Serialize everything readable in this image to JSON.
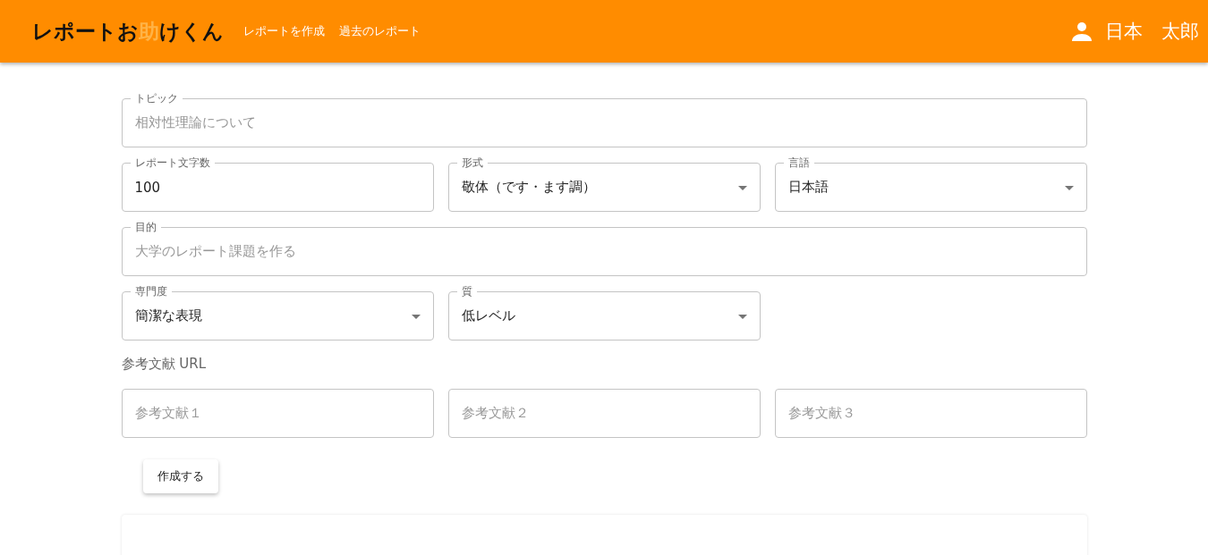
{
  "header": {
    "logo": [
      {
        "text": "レポートお",
        "highlight": false
      },
      {
        "text": "助",
        "highlight": true
      },
      {
        "text": "けくん",
        "highlight": false
      }
    ],
    "nav": [
      {
        "label": "レポートを作成"
      },
      {
        "label": "過去のレポート"
      }
    ],
    "user": {
      "name": "日本　太郎"
    }
  },
  "form": {
    "rows": [
      [
        {
          "kind": "text",
          "label": "トピック",
          "placeholder": "相対性理論について"
        }
      ],
      [
        {
          "kind": "text",
          "label": "レポート文字数",
          "value": "100"
        },
        {
          "kind": "select",
          "label": "形式",
          "value": "敬体（です・ます調）"
        },
        {
          "kind": "select",
          "label": "言語",
          "value": "日本語"
        }
      ],
      [
        {
          "kind": "text",
          "label": "目的",
          "placeholder": "大学のレポート課題を作る"
        }
      ],
      [
        {
          "kind": "select",
          "label": "専門度",
          "value": "簡潔な表現"
        },
        {
          "kind": "select",
          "label": "質",
          "value": "低レベル"
        }
      ]
    ],
    "references_label": "参考文献 URL",
    "references": [
      {
        "placeholder": "参考文献１"
      },
      {
        "placeholder": "参考文献２"
      },
      {
        "placeholder": "参考文献３"
      }
    ],
    "submit": "作成する"
  }
}
